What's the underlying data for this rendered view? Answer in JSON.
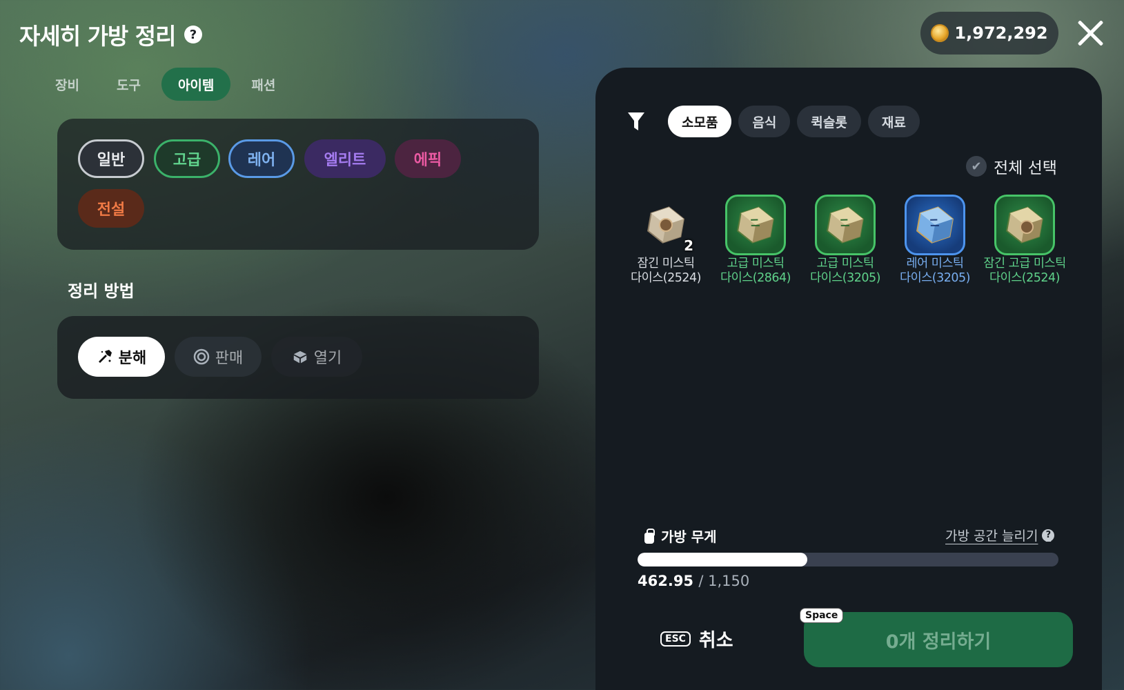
{
  "header": {
    "title": "자세히 가방 정리",
    "help_glyph": "?",
    "gold": "1,972,292",
    "close_icon": "close-icon"
  },
  "tabs": [
    {
      "label": "장비",
      "active": false
    },
    {
      "label": "도구",
      "active": false
    },
    {
      "label": "아이템",
      "active": true
    },
    {
      "label": "패션",
      "active": false
    }
  ],
  "grades": {
    "normal": "일반",
    "advanced": "고급",
    "rare": "레어",
    "elite": "엘리트",
    "epic": "에픽",
    "legend": "전설"
  },
  "method": {
    "title": "정리 방법",
    "dismantle": "분해",
    "sell": "판매",
    "open": "열기"
  },
  "right": {
    "sub_tabs": [
      {
        "label": "소모품",
        "active": true
      },
      {
        "label": "음식",
        "active": false
      },
      {
        "label": "퀵슬롯",
        "active": false
      },
      {
        "label": "재료",
        "active": false
      }
    ],
    "select_all": "전체 선택",
    "items": [
      {
        "line1": "잠긴 미스틱",
        "line2": "다이스(2524)",
        "grade": "normal",
        "count": "2",
        "locked": true
      },
      {
        "line1": "고급 미스틱",
        "line2": "다이스(2864)",
        "grade": "advanced",
        "count": "",
        "locked": false
      },
      {
        "line1": "고급 미스틱",
        "line2": "다이스(3205)",
        "grade": "advanced",
        "count": "",
        "locked": false
      },
      {
        "line1": "레어 미스틱",
        "line2": "다이스(3205)",
        "grade": "rare",
        "count": "",
        "locked": false
      },
      {
        "line1": "잠긴 고급 미스틱",
        "line2": "다이스(2524)",
        "grade": "advanced",
        "count": "",
        "locked": true
      }
    ]
  },
  "weight": {
    "label": "가방 무게",
    "expand_link": "가방 공간 늘리기",
    "current": "462.95",
    "max": "/ 1,150",
    "fraction": 0.4026
  },
  "footer": {
    "esc": "ESC",
    "cancel": "취소",
    "space": "Space",
    "confirm": "0개 정리하기"
  },
  "colors": {
    "accent_green": "#22704a",
    "normal": "#c7cbd0",
    "advanced": "#3bb26a",
    "rare": "#5a9ae6",
    "elite": "#a57cf0",
    "epic": "#ec5aa3",
    "legend": "#f07a45"
  }
}
